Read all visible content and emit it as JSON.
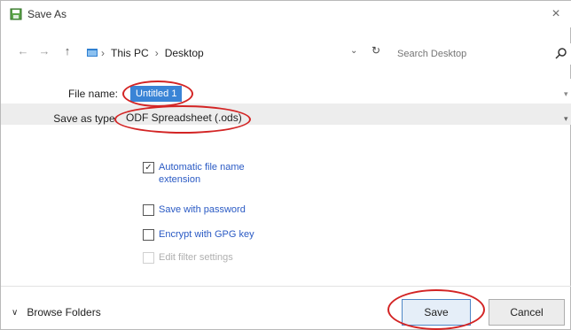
{
  "window": {
    "title": "Save As",
    "close_label": "×"
  },
  "nav": {
    "back": "←",
    "forward": "→",
    "up": "↑",
    "breadcrumb": [
      "This PC",
      "Desktop"
    ],
    "separator": "›",
    "dropdown": "⌄",
    "refresh": "↻",
    "search_placeholder": "Search Desktop"
  },
  "form": {
    "file_name_label": "File name:",
    "file_name_value": "Untitled 1",
    "save_as_type_label": "Save as type:",
    "save_as_type_value": "ODF Spreadsheet (.ods)"
  },
  "options": [
    {
      "label": "Automatic file name extension",
      "checked": true,
      "enabled": true
    },
    {
      "label": "Save with password",
      "checked": false,
      "enabled": true
    },
    {
      "label": "Encrypt with GPG key",
      "checked": false,
      "enabled": true
    },
    {
      "label": "Edit filter settings",
      "checked": false,
      "enabled": false
    }
  ],
  "footer": {
    "browse_folders": "Browse Folders",
    "save_label": "Save",
    "cancel_label": "Cancel"
  }
}
